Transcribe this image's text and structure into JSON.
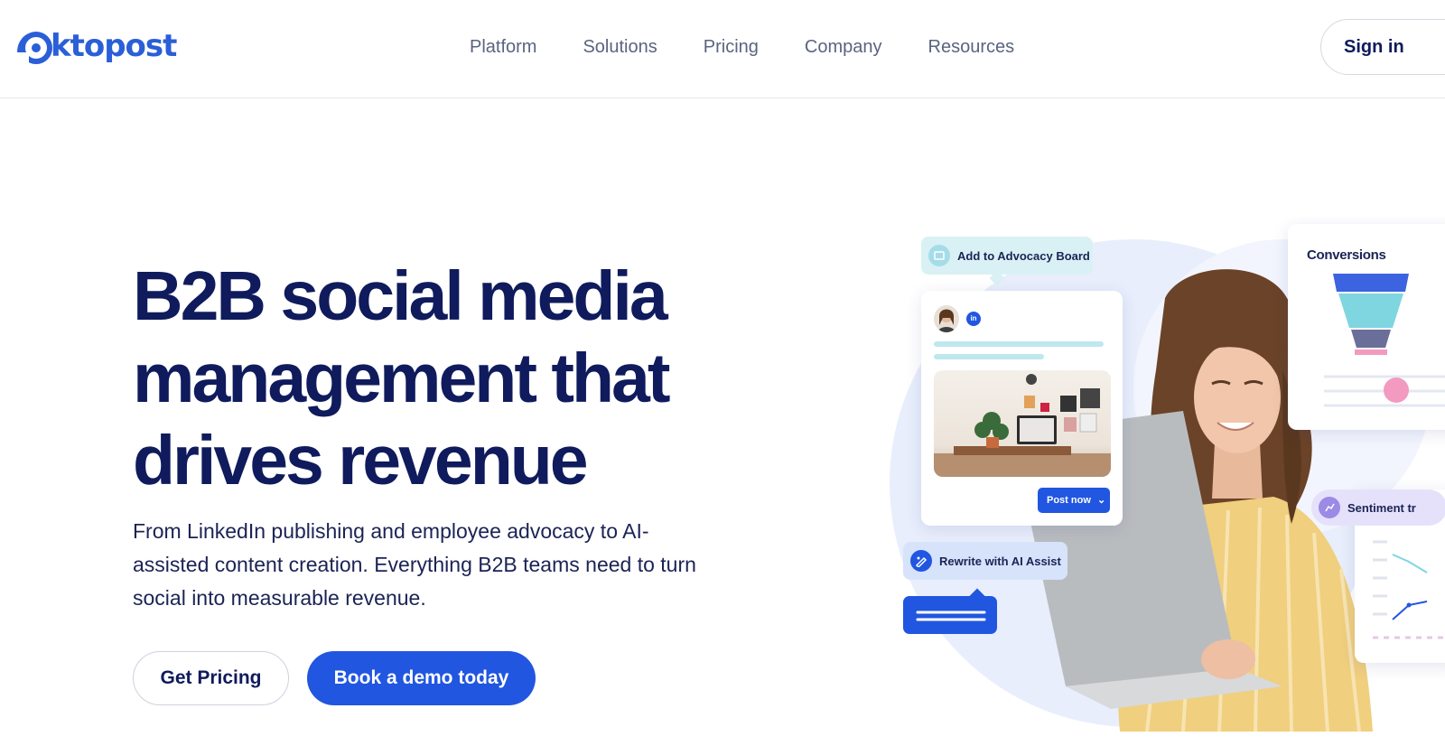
{
  "header": {
    "logo_text": "ktopost",
    "nav": [
      "Platform",
      "Solutions",
      "Pricing",
      "Company",
      "Resources"
    ],
    "signin_label": "Sign in"
  },
  "hero": {
    "headline": "B2B social media management that drives revenue",
    "subtext": "From LinkedIn publishing and employee advocacy to AI-assisted content creation. Everything B2B teams need to turn social into measurable revenue.",
    "cta_secondary": "Get Pricing",
    "cta_primary": "Book a demo today"
  },
  "illustration": {
    "advocacy_label": "Add to Advocacy Board",
    "post_now_label": "Post now",
    "rewrite_label": "Rewrite with AI Assist",
    "conversions_title": "Conversions",
    "sentiment_label": "Sentiment tr"
  },
  "colors": {
    "brand_blue": "#2156e0",
    "navy": "#0f1b5c",
    "teal": "#7fd6e0"
  }
}
